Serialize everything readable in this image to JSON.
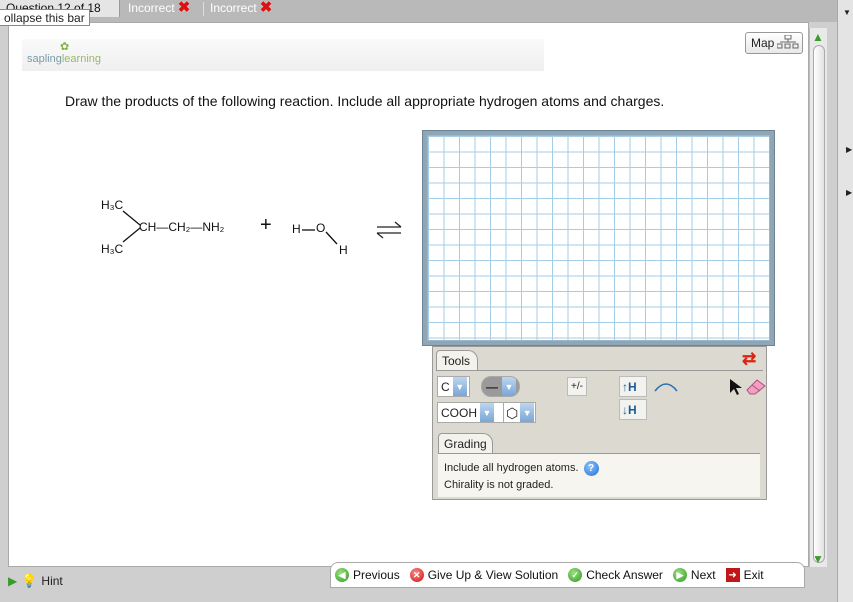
{
  "header": {
    "question_label": "Question 12 of 18",
    "tabs": [
      {
        "label": "Incorrect"
      },
      {
        "label": "Incorrect"
      }
    ],
    "collapse_label": "ollapse this bar"
  },
  "brand": {
    "sapling": "sapling",
    "learning": "learning"
  },
  "map_button": {
    "label": "Map"
  },
  "prompt": "Draw the products of the following reaction. Include all appropriate hydrogen atoms and charges.",
  "reaction": {
    "h3c_top": "H₃C",
    "chain": "CH—CH₂—NH₂",
    "h3c_bottom": "H₃C",
    "plus": "+",
    "water_h": "H",
    "water_o": "O",
    "water_h2": "H",
    "equilibrium": "⇌"
  },
  "tools": {
    "tab_label": "Tools",
    "element_value": "C",
    "bond_value": "—",
    "charge_label": "+/-",
    "add_h_label": "↑H",
    "remove_h_label": "↓H",
    "template_value": "COOH",
    "ring_value": "⬡"
  },
  "grading": {
    "tab_label": "Grading",
    "line1": "Include all hydrogen atoms.",
    "line2": "Chirality is not graded."
  },
  "hint": {
    "label": "Hint"
  },
  "nav": {
    "previous": "Previous",
    "give_up": "Give Up & View Solution",
    "check": "Check Answer",
    "next": "Next",
    "exit": "Exit"
  },
  "colors": {
    "grid_line": "#a6cde6",
    "canvas_frame": "#8fa6b7",
    "tools_bg": "#dcdad0",
    "incorrect_x": "#dd1111",
    "accent_blue": "#7aa6d4"
  },
  "icons": [
    "incorrect-x-icon",
    "map-icon",
    "refresh-icon",
    "select-arrow-icon",
    "eraser-icon",
    "help-icon",
    "hint-bulb-icon",
    "previous-icon",
    "give-up-icon",
    "check-icon",
    "next-icon",
    "exit-icon"
  ]
}
